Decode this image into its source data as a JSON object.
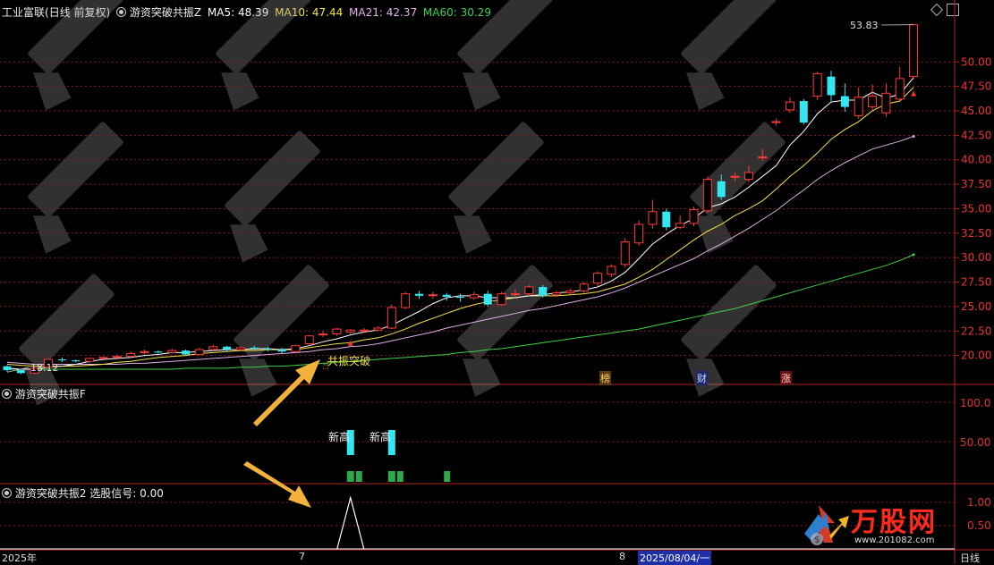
{
  "header": {
    "stock_name": "工业富联",
    "period": "(日线 前复权)",
    "indicator_name": "游资突破共振Z",
    "ma5_label": "MA5: 48.39",
    "ma10_label": "MA10: 47.44",
    "ma21_label": "MA21: 42.37",
    "ma60_label": "MA60: 30.29"
  },
  "main_panel": {
    "price_ticks": [
      "50.00",
      "47.50",
      "45.00",
      "42.50",
      "40.00",
      "37.50",
      "35.00",
      "32.50",
      "30.00",
      "27.50",
      "25.00",
      "22.50",
      "20.00"
    ],
    "high_annotation": "53.83",
    "low_annotation": "18.12",
    "signal_label": "共振突破",
    "event_markers": [
      "榜",
      "财",
      "涨"
    ]
  },
  "panel_f": {
    "title": "游资突破共振F",
    "ticks": [
      "100.0",
      "50.00"
    ],
    "labels": [
      "新高",
      "新高"
    ]
  },
  "panel_2": {
    "title": "游资突破共振2",
    "signal_text": "选股信号: 0.00",
    "ticks": [
      "1.00",
      "0.50"
    ]
  },
  "time_axis": {
    "year_label": "2025年",
    "month_7": "7",
    "month_8": "8",
    "cursor_date": "2025/08/04/一",
    "mode_label": "日线"
  },
  "watermark": {
    "brand": "万股网",
    "url": "www.201082.com"
  },
  "colors": {
    "up": "#ff3b3b",
    "down": "#35e6f0",
    "ma5": "#ffffff",
    "ma10": "#f7e34a",
    "ma21": "#e0b0e8",
    "ma60": "#3fd14a",
    "grid": "#8b1a1a",
    "border": "#b22222"
  },
  "chart_data": {
    "type": "candlestick",
    "x": [
      "2025-06-13",
      "2025-06-16",
      "2025-06-17",
      "2025-06-18",
      "2025-06-19",
      "2025-06-20",
      "2025-06-23",
      "2025-06-24",
      "2025-06-25",
      "2025-06-26",
      "2025-06-27",
      "2025-06-30",
      "2025-07-01",
      "2025-07-02",
      "2025-07-03",
      "2025-07-04",
      "2025-07-07",
      "2025-07-08",
      "2025-07-09",
      "2025-07-10",
      "2025-07-11",
      "2025-07-14",
      "2025-07-15",
      "2025-07-16",
      "2025-07-17",
      "2025-07-18",
      "2025-07-21",
      "2025-07-22",
      "2025-07-23",
      "2025-07-24",
      "2025-07-25",
      "2025-07-28",
      "2025-07-29",
      "2025-07-30",
      "2025-07-31",
      "2025-08-01",
      "2025-08-04",
      "2025-08-05",
      "2025-08-06",
      "2025-08-07",
      "2025-08-08",
      "2025-08-11",
      "2025-08-12",
      "2025-08-13",
      "2025-08-14",
      "2025-08-15",
      "2025-08-18",
      "2025-08-19",
      "2025-08-20",
      "2025-08-21",
      "2025-08-22",
      "2025-08-25",
      "2025-08-26",
      "2025-08-27",
      "2025-08-28",
      "2025-08-29",
      "2025-09-01",
      "2025-09-02",
      "2025-09-03",
      "2025-09-04",
      "2025-09-05",
      "2025-09-08",
      "2025-09-09",
      "2025-09-10",
      "2025-09-11",
      "2025-09-12",
      "2025-09-15"
    ],
    "open": [
      18.9,
      18.5,
      18.2,
      18.8,
      19.6,
      19.5,
      19.4,
      19.7,
      19.8,
      19.9,
      20.3,
      20.4,
      20.3,
      20.5,
      20.1,
      20.6,
      20.9,
      20.6,
      20.8,
      20.7,
      20.6,
      20.4,
      21.2,
      22.1,
      22.2,
      22.4,
      22.5,
      22.6,
      22.8,
      24.9,
      26.3,
      26.2,
      26.2,
      26.0,
      25.9,
      26.3,
      25.2,
      26.3,
      26.3,
      27.0,
      26.2,
      26.4,
      26.6,
      27.4,
      28.3,
      29.3,
      31.5,
      33.4,
      34.7,
      33.1,
      33.5,
      34.8,
      37.8,
      38.3,
      38.0,
      40.2,
      43.9,
      45.1,
      46.0,
      46.5,
      48.5,
      46.5,
      44.5,
      45.4,
      44.8,
      46.2,
      48.5
    ],
    "close": [
      18.5,
      18.2,
      18.7,
      19.6,
      19.5,
      19.4,
      19.7,
      19.8,
      19.9,
      20.2,
      20.4,
      20.3,
      20.5,
      20.1,
      20.6,
      20.9,
      20.6,
      20.8,
      20.7,
      20.6,
      20.4,
      21.0,
      22.0,
      22.2,
      22.7,
      22.6,
      22.6,
      22.8,
      24.9,
      26.3,
      26.1,
      26.2,
      26.0,
      25.9,
      26.2,
      25.2,
      26.3,
      26.3,
      27.0,
      26.1,
      26.4,
      26.6,
      27.3,
      28.4,
      29.1,
      31.6,
      33.4,
      34.7,
      33.1,
      33.5,
      34.9,
      38.0,
      36.2,
      38.3,
      38.7,
      40.3,
      43.9,
      45.9,
      43.8,
      48.8,
      46.6,
      45.4,
      46.4,
      46.5,
      46.8,
      48.3,
      53.8
    ],
    "high": [
      19.0,
      18.6,
      18.8,
      19.7,
      19.8,
      19.6,
      19.8,
      19.9,
      20.1,
      20.4,
      20.6,
      20.5,
      20.7,
      20.6,
      20.8,
      21.1,
      21.0,
      20.9,
      21.0,
      20.9,
      20.8,
      21.1,
      22.1,
      22.5,
      22.8,
      22.7,
      22.8,
      23.0,
      25.2,
      26.5,
      26.6,
      26.5,
      26.4,
      26.3,
      26.5,
      26.6,
      26.5,
      26.8,
      27.2,
      27.2,
      26.6,
      26.8,
      27.5,
      28.6,
      29.3,
      32.0,
      33.8,
      35.9,
      35.0,
      34.3,
      35.2,
      38.3,
      38.5,
      38.7,
      39.4,
      41.1,
      44.2,
      46.4,
      46.2,
      49.0,
      49.1,
      47.8,
      47.4,
      47.7,
      47.8,
      49.5,
      53.8
    ],
    "low": [
      18.3,
      18.1,
      18.1,
      18.7,
      19.3,
      19.3,
      19.2,
      19.6,
      19.7,
      19.8,
      20.1,
      20.2,
      20.2,
      20.0,
      20.0,
      20.5,
      20.4,
      20.5,
      20.5,
      20.4,
      20.2,
      20.3,
      21.1,
      21.9,
      22.0,
      22.2,
      22.3,
      22.5,
      22.7,
      24.7,
      25.8,
      25.8,
      25.6,
      25.5,
      25.7,
      25.0,
      25.1,
      26.0,
      26.1,
      25.9,
      26.0,
      26.2,
      26.4,
      27.1,
      28.0,
      29.0,
      31.2,
      33.0,
      32.8,
      32.9,
      33.2,
      34.6,
      35.9,
      37.8,
      37.7,
      39.9,
      43.5,
      44.8,
      43.6,
      46.1,
      45.9,
      44.9,
      44.2,
      45.1,
      44.4,
      45.9,
      48.2
    ],
    "ma5": [
      18.7,
      18.6,
      18.6,
      18.8,
      18.9,
      19.1,
      19.4,
      19.6,
      19.7,
      19.8,
      20.0,
      20.1,
      20.3,
      20.3,
      20.4,
      20.5,
      20.6,
      20.6,
      20.7,
      20.7,
      20.6,
      20.7,
      21.0,
      21.4,
      21.7,
      22.1,
      22.4,
      22.6,
      23.1,
      23.8,
      24.5,
      25.3,
      25.9,
      26.1,
      26.1,
      25.9,
      25.9,
      25.9,
      26.1,
      26.2,
      26.4,
      26.5,
      26.7,
      27.0,
      27.6,
      28.5,
      29.9,
      31.4,
      32.4,
      33.3,
      34.0,
      35.1,
      35.5,
      36.2,
      37.2,
      38.3,
      39.4,
      41.5,
      42.9,
      44.7,
      45.9,
      46.1,
      46.1,
      46.9,
      46.3,
      46.7,
      48.4
    ],
    "ma10": [
      19.1,
      19.0,
      18.9,
      18.9,
      18.9,
      18.9,
      19.0,
      19.1,
      19.3,
      19.4,
      19.6,
      19.8,
      19.9,
      20.0,
      20.2,
      20.3,
      20.4,
      20.5,
      20.5,
      20.6,
      20.6,
      20.6,
      20.8,
      21.0,
      21.2,
      21.3,
      21.6,
      21.8,
      22.2,
      22.7,
      23.3,
      23.8,
      24.3,
      24.8,
      25.2,
      25.5,
      25.7,
      25.9,
      26.1,
      26.1,
      26.1,
      26.2,
      26.3,
      26.5,
      26.9,
      27.3,
      28.0,
      28.8,
      29.8,
      30.8,
      31.8,
      32.7,
      33.4,
      34.3,
      35.0,
      35.8,
      37.0,
      38.3,
      39.4,
      40.7,
      42.1,
      43.1,
      43.9,
      45.0,
      45.7,
      46.0,
      47.4
    ],
    "ma21": [
      19.3,
      19.2,
      19.1,
      19.1,
      19.1,
      19.1,
      19.1,
      19.1,
      19.1,
      19.2,
      19.2,
      19.3,
      19.4,
      19.5,
      19.6,
      19.7,
      19.8,
      19.9,
      20.0,
      20.1,
      20.2,
      20.3,
      20.4,
      20.6,
      20.7,
      20.9,
      21.0,
      21.2,
      21.5,
      21.8,
      22.1,
      22.4,
      22.8,
      23.1,
      23.4,
      23.7,
      24.0,
      24.3,
      24.6,
      24.8,
      25.1,
      25.4,
      25.7,
      26.0,
      26.4,
      26.9,
      27.5,
      28.1,
      28.7,
      29.3,
      29.9,
      30.7,
      31.4,
      32.2,
      33.0,
      33.9,
      34.8,
      35.9,
      36.9,
      38.0,
      38.9,
      39.7,
      40.4,
      41.1,
      41.5,
      41.9,
      42.4
    ],
    "ma60": [
      18.6,
      18.6,
      18.6,
      18.6,
      18.6,
      18.6,
      18.6,
      18.6,
      18.6,
      18.6,
      18.6,
      18.6,
      18.6,
      18.7,
      18.7,
      18.7,
      18.7,
      18.8,
      18.8,
      18.9,
      18.9,
      19.0,
      19.1,
      19.2,
      19.3,
      19.4,
      19.5,
      19.6,
      19.7,
      19.8,
      19.9,
      20.0,
      20.1,
      20.3,
      20.4,
      20.6,
      20.7,
      20.9,
      21.1,
      21.3,
      21.5,
      21.7,
      21.9,
      22.1,
      22.3,
      22.5,
      22.7,
      23.0,
      23.3,
      23.6,
      23.9,
      24.2,
      24.5,
      24.8,
      25.2,
      25.6,
      26.0,
      26.4,
      26.8,
      27.2,
      27.6,
      28.0,
      28.4,
      28.8,
      29.2,
      29.7,
      30.3
    ],
    "ylim": [
      17.5,
      54.5
    ],
    "yticks": [
      20,
      22.5,
      25,
      27.5,
      30,
      32.5,
      35,
      37.5,
      40,
      42.5,
      45,
      47.5,
      50
    ],
    "panel_f_bars": [
      {
        "index": 25,
        "value": 60,
        "label": "新高"
      },
      {
        "index": 28,
        "value": 60,
        "label": "新高"
      }
    ],
    "panel_2_signal": [
      {
        "index": 25,
        "value": 1.0
      }
    ],
    "panel_2_ylim": [
      0,
      1.15
    ]
  }
}
